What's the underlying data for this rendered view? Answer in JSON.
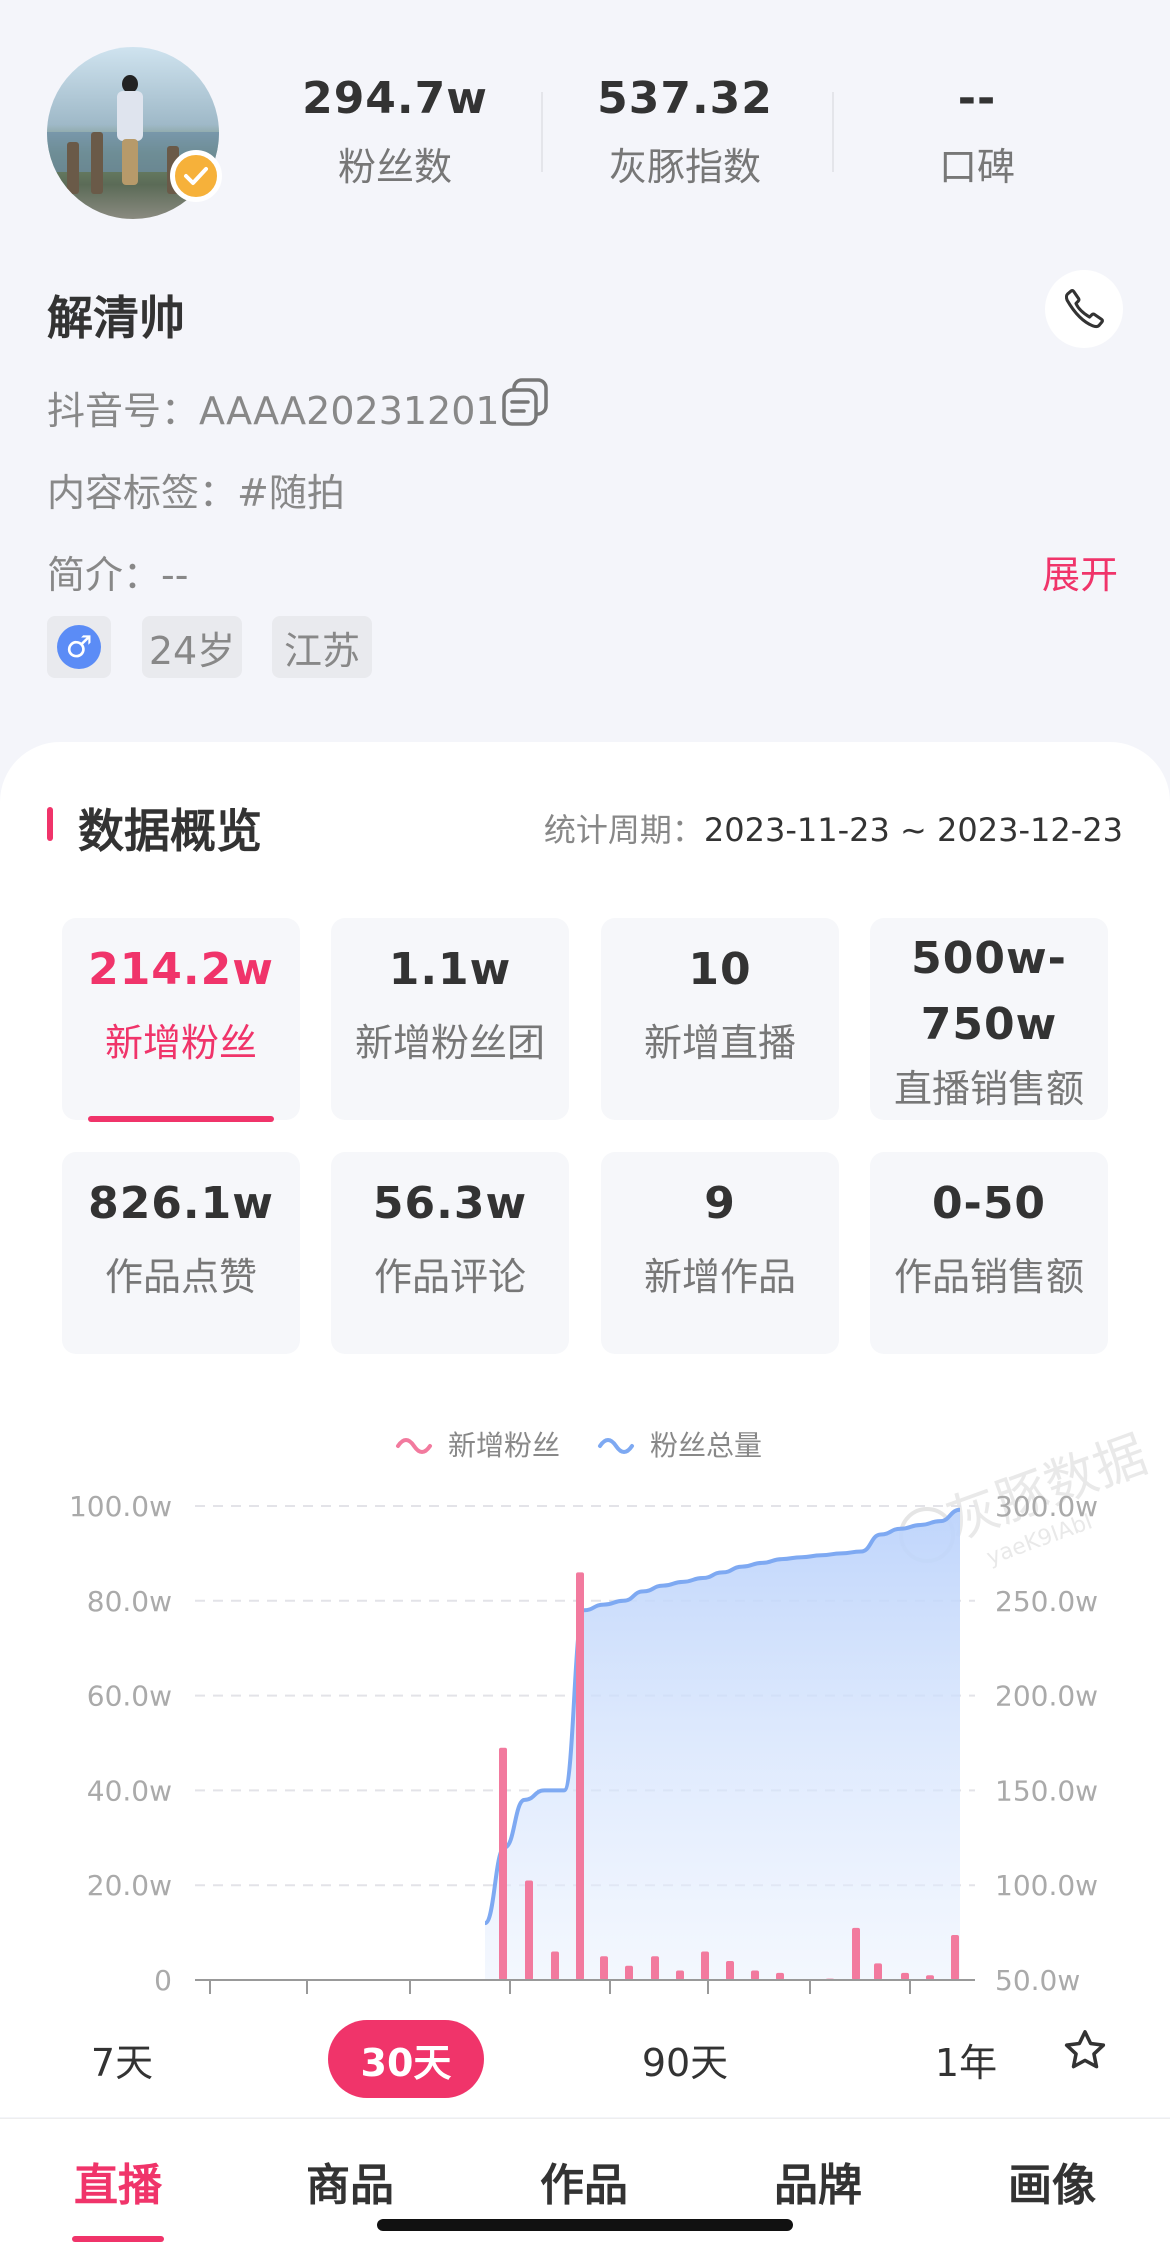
{
  "profile": {
    "name": "解清帅",
    "douyin_id_label": "抖音号：",
    "douyin_id": "AAAA20231201",
    "content_tag_label": "内容标签：",
    "content_tag": "#随拍",
    "intro_label": "简介：",
    "intro": "--",
    "expand_label": "展开",
    "age": "24岁",
    "region": "江苏",
    "gender_symbol": "♂",
    "verified": true
  },
  "stats": [
    {
      "value": "294.7w",
      "label": "粉丝数"
    },
    {
      "value": "537.32",
      "label": "灰豚指数"
    },
    {
      "value": "--",
      "label": "口碑"
    }
  ],
  "overview": {
    "title": "数据概览",
    "period_label": "统计周期：",
    "period_value": "2023-11-23 ~ 2023-12-23",
    "tiles": [
      {
        "value": "214.2w",
        "label": "新增粉丝"
      },
      {
        "value": "1.1w",
        "label": "新增粉丝团"
      },
      {
        "value": "10",
        "label": "新增直播"
      },
      {
        "value_line1": "500w-",
        "value_line2": "750w",
        "label": "直播销售额"
      },
      {
        "value": "826.1w",
        "label": "作品点赞"
      },
      {
        "value": "56.3w",
        "label": "作品评论"
      },
      {
        "value": "9",
        "label": "新增作品"
      },
      {
        "value": "0-50",
        "label": "作品销售额"
      }
    ]
  },
  "colors": {
    "accent": "#f0346a",
    "bar": "#f27a9e",
    "line": "#7ea9f2",
    "area": "#c9dcfb"
  },
  "chart_data": {
    "type": "bar+line",
    "legend_position": "top-center",
    "series": [
      {
        "name": "新增粉丝",
        "axis": "left",
        "type": "bar",
        "values": [
          49,
          21,
          6,
          86,
          5,
          3,
          5,
          2,
          6,
          4,
          2,
          1.5,
          0.3,
          11,
          3.5,
          1.5,
          1,
          9.5
        ]
      },
      {
        "name": "粉丝总量",
        "axis": "right",
        "type": "area-line",
        "values": [
          80,
          120,
          145,
          150,
          150,
          245,
          248,
          250,
          255,
          258,
          260,
          262,
          265,
          268,
          270,
          272,
          273,
          274,
          275,
          276,
          285,
          288,
          290,
          292,
          298
        ]
      }
    ],
    "y_left": {
      "ticks": [
        "0",
        "20.0w",
        "40.0w",
        "60.0w",
        "80.0w",
        "100.0w"
      ],
      "min": 0,
      "max": 100
    },
    "y_right": {
      "ticks": [
        "50.0w",
        "100.0w",
        "150.0w",
        "200.0w",
        "250.0w",
        "300.0w"
      ],
      "min": 50,
      "max": 300
    },
    "watermark": "灰豚数据",
    "watermark_sub": "yaeK9IAbI",
    "grid": "dashed horizontal"
  },
  "periods": {
    "options": [
      "7天",
      "30天",
      "90天",
      "1年"
    ],
    "selected": "30天"
  },
  "bottom_tabs": {
    "items": [
      "直播",
      "商品",
      "作品",
      "品牌",
      "画像"
    ],
    "selected": "直播"
  }
}
